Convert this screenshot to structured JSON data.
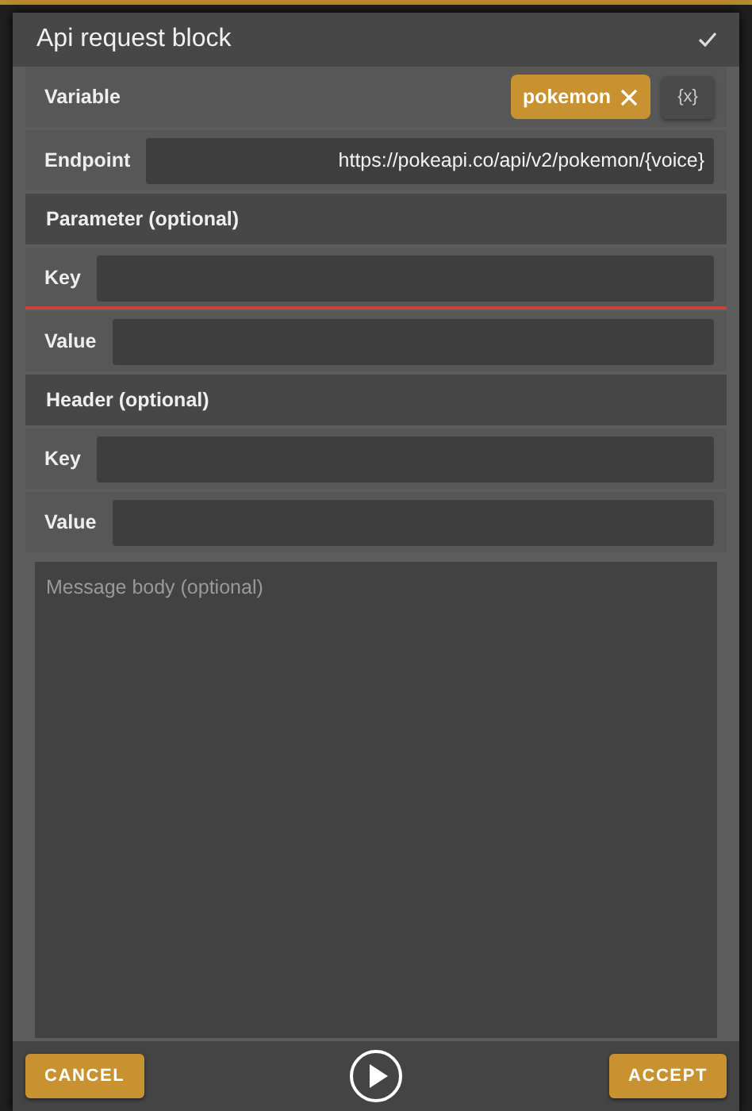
{
  "dialog": {
    "title": "Api request block"
  },
  "variable": {
    "label": "Variable",
    "chip": "pokemon",
    "insert_button": "{x}"
  },
  "endpoint": {
    "label": "Endpoint",
    "value": "https://pokeapi.co/api/v2/pokemon/{voice}"
  },
  "sections": [
    {
      "title": "Parameter (optional)",
      "fields": [
        {
          "label": "Key",
          "focused": true
        },
        {
          "label": "Value",
          "focused": false
        }
      ]
    },
    {
      "title": "Header (optional)",
      "fields": [
        {
          "label": "Key",
          "focused": false
        },
        {
          "label": "Value",
          "focused": false
        }
      ]
    }
  ],
  "body": {
    "placeholder": "Message body (optional)"
  },
  "footer": {
    "cancel": "CANCEL",
    "accept": "ACCEPT"
  }
}
